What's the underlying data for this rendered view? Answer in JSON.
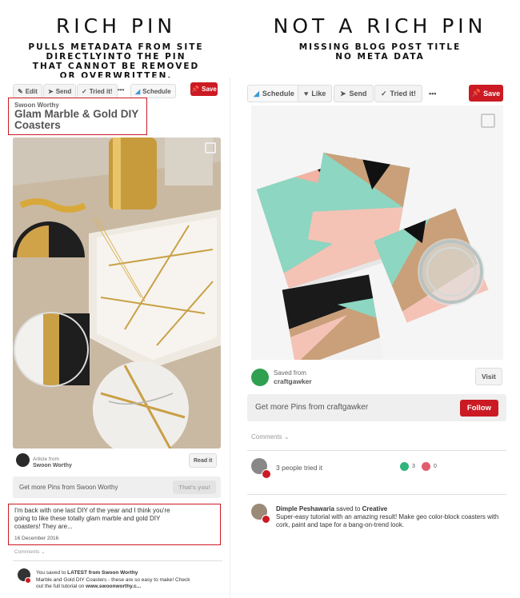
{
  "left_header": {
    "title": "RICH PIN",
    "sub1": "PULLS METADATA FROM SITE",
    "sub2": "DIRECTLYINTO THE PIN",
    "sub3": "THAT CANNOT BE REMOVED",
    "sub4": "OR OVERWRITTEN."
  },
  "right_header": {
    "title": "NOT A RICH PIN",
    "sub1": "MISSING BLOG POST TITLE",
    "sub2": "NO META DATA"
  },
  "left_pin": {
    "toolbar": {
      "edit": "Edit",
      "send": "Send",
      "tried": "Tried it!",
      "more": "•••",
      "schedule": "Schedule",
      "save": "Save"
    },
    "site_name": "Swoon Worthy",
    "title": "Glam Marble & Gold DIY Coasters",
    "article_from": "Article from",
    "source": "Swoon Worthy",
    "read_it": "Read it",
    "more_pins": "Get more Pins from Swoon Worthy",
    "thats_you": "That's you!",
    "description": "I'm back with one last DIY of the year and I think you're going to like these totally glam marble and gold DIY coasters! They are...",
    "date": "16 December 2016",
    "comments": "Comments",
    "activity_user": "You saved to",
    "activity_board": "LATEST from Swoon Worthy",
    "activity_text": "Marble and Gold DIY Coasters - these are so easy to make! Check out the full tutorial on",
    "activity_link": "www.swoonworthy.c..."
  },
  "right_pin": {
    "toolbar": {
      "schedule": "Schedule",
      "like": "Like",
      "send": "Send",
      "tried": "Tried it!",
      "more": "•••",
      "save": "Save"
    },
    "saved_from": "Saved from",
    "source": "craftgawker",
    "visit": "Visit",
    "more_pins": "Get more Pins from craftgawker",
    "follow": "Follow",
    "comments": "Comments",
    "tried_count": "3 people tried it",
    "happy_count": "3",
    "sad_count": "0",
    "activity_user": "Dimple Peshawaria",
    "activity_saved": "saved to",
    "activity_board": "Creative",
    "activity_text": "Super-easy tutorial with an amazing result! Make geo color-block coasters with cork, paint and tape for a bang-on-trend look."
  },
  "colors": {
    "red": "#cb1a23",
    "green": "#2fb47a",
    "pink": "#e25c6f",
    "mint": "#8dd6c1",
    "coral": "#f2b2a4"
  }
}
